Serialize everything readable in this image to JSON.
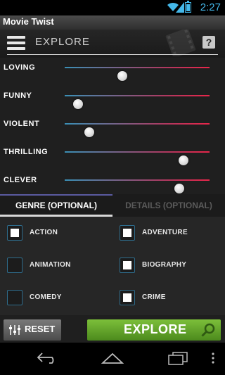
{
  "status_bar": {
    "time": "2:27"
  },
  "window": {
    "title": "Movie Twist"
  },
  "header": {
    "title": "EXPLORE",
    "help_label": "?"
  },
  "sliders": [
    {
      "label": "LOVING",
      "value": 0.4
    },
    {
      "label": "FUNNY",
      "value": 0.09
    },
    {
      "label": "VIOLENT",
      "value": 0.17
    },
    {
      "label": "THRILLING",
      "value": 0.82
    },
    {
      "label": "CLEVER",
      "value": 0.79
    }
  ],
  "tabs": [
    {
      "label": "GENRE (OPTIONAL)",
      "active": true
    },
    {
      "label": "DETAILS (OPTIONAL)",
      "active": false
    }
  ],
  "genres": [
    {
      "label": "ACTION",
      "checked": true
    },
    {
      "label": "ADVENTURE",
      "checked": true
    },
    {
      "label": "ANIMATION",
      "checked": false
    },
    {
      "label": "BIOGRAPHY",
      "checked": true
    },
    {
      "label": "COMEDY",
      "checked": false
    },
    {
      "label": "CRIME",
      "checked": true
    }
  ],
  "buttons": {
    "reset": "RESET",
    "explore": "EXPLORE"
  },
  "colors": {
    "accent_blue": "#44b8ea",
    "explore_green": "#6aad2e",
    "slider_start": "#3a8fb5",
    "slider_end": "#e8264a"
  },
  "icons": {
    "menu": "menu-icon",
    "help": "help-icon",
    "reset": "sliders-icon",
    "explore": "magnifier-icon",
    "nav_back": "back-icon",
    "nav_home": "home-icon",
    "nav_recent": "recent-apps-icon",
    "nav_overflow": "overflow-icon"
  }
}
